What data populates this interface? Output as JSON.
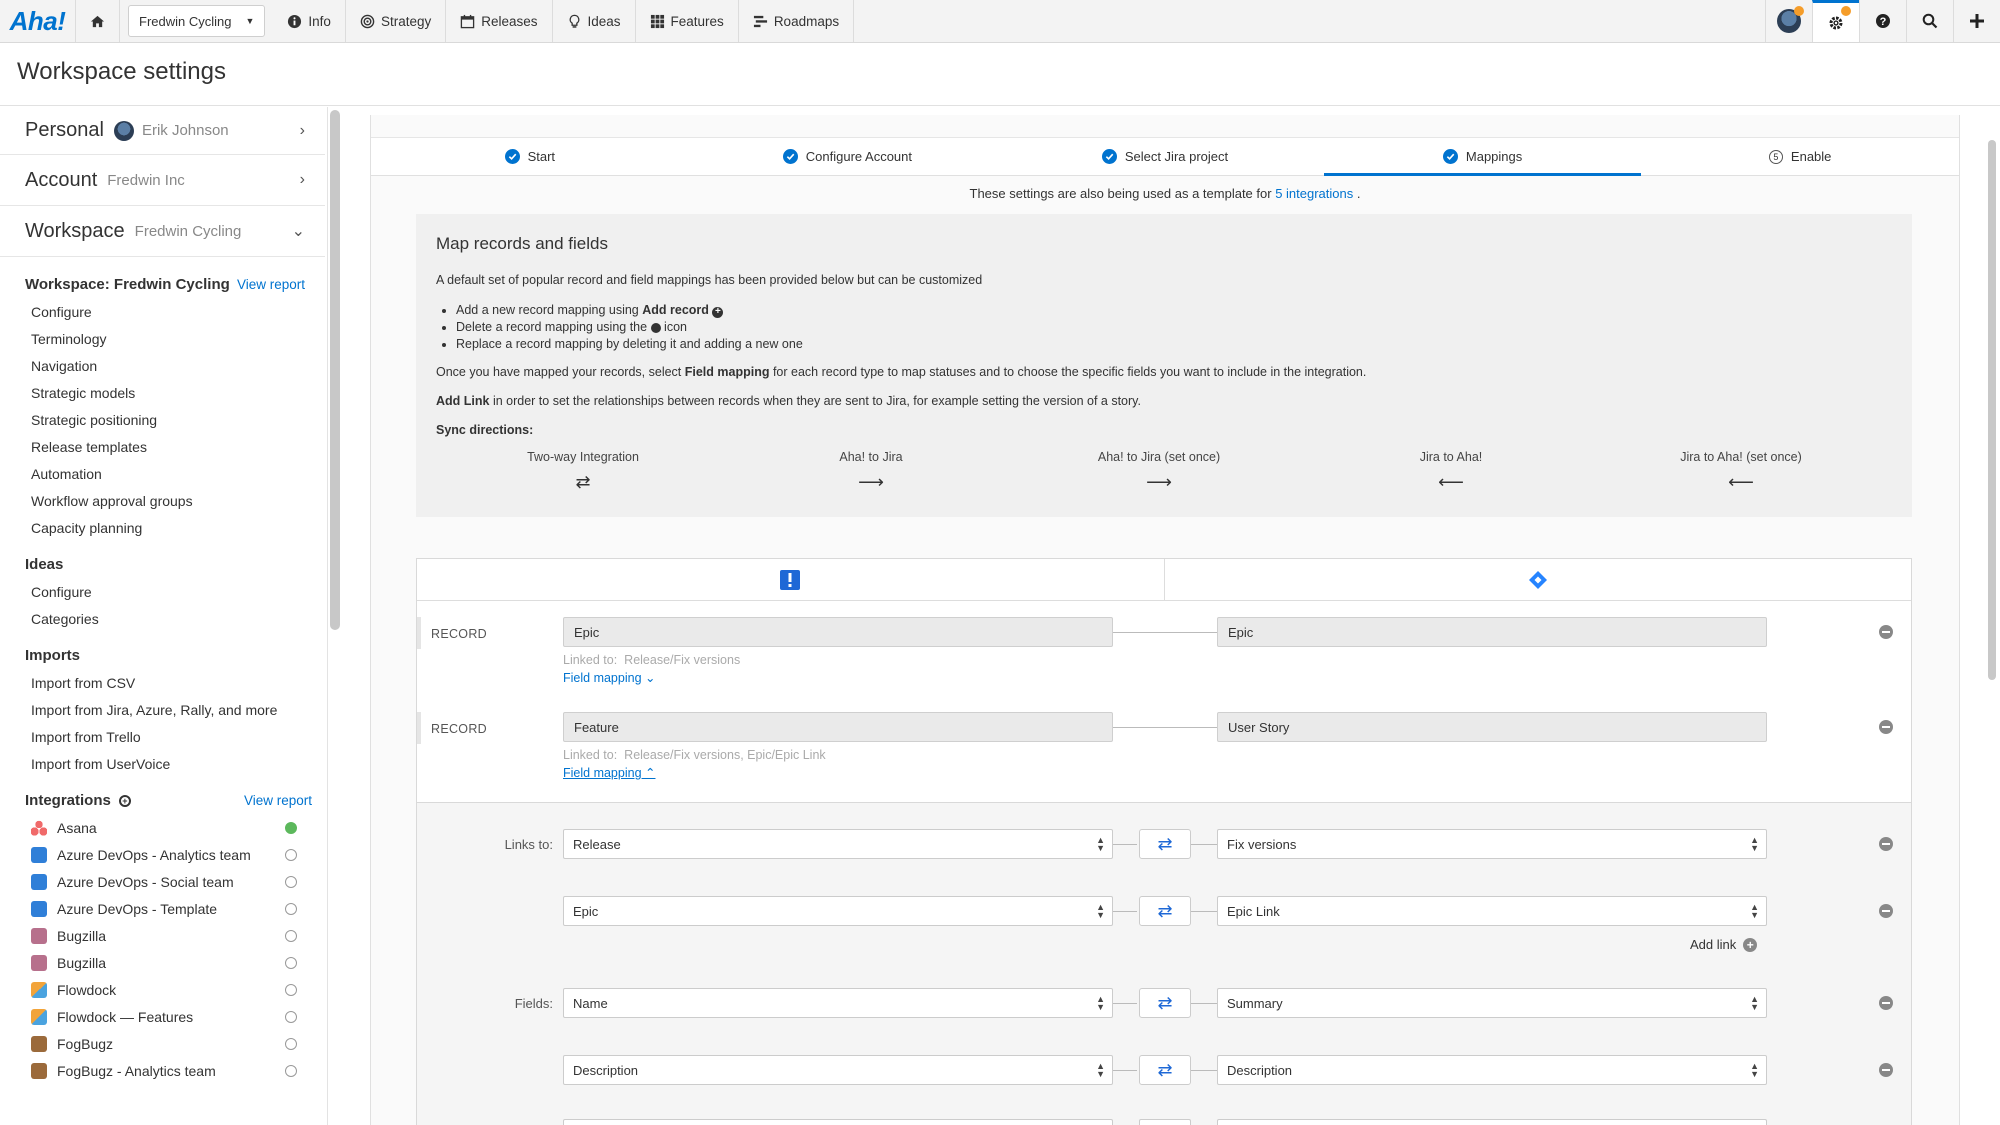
{
  "nav": {
    "logo": "Aha!",
    "workspace": "Fredwin Cycling",
    "items": [
      "Info",
      "Strategy",
      "Releases",
      "Ideas",
      "Features",
      "Roadmaps"
    ]
  },
  "page": {
    "title": "Workspace settings"
  },
  "sidebar": {
    "personal": {
      "label": "Personal",
      "value": "Erik Johnson"
    },
    "account": {
      "label": "Account",
      "value": "Fredwin Inc"
    },
    "workspace": {
      "label": "Workspace",
      "value": "Fredwin Cycling"
    },
    "ws_section": {
      "title": "Workspace: Fredwin Cycling",
      "link": "View report",
      "items": [
        "Configure",
        "Terminology",
        "Navigation",
        "Strategic models",
        "Strategic positioning",
        "Release templates",
        "Automation",
        "Workflow approval groups",
        "Capacity planning"
      ]
    },
    "ideas": {
      "title": "Ideas",
      "items": [
        "Configure",
        "Categories"
      ]
    },
    "imports": {
      "title": "Imports",
      "items": [
        "Import from CSV",
        "Import from Jira, Azure, Rally, and more",
        "Import from Trello",
        "Import from UserVoice"
      ]
    },
    "integrations": {
      "title": "Integrations",
      "link": "View report",
      "items": [
        "Asana",
        "Azure DevOps - Analytics team",
        "Azure DevOps - Social team",
        "Azure DevOps - Template",
        "Bugzilla",
        "Bugzilla",
        "Flowdock",
        "Flowdock — Features",
        "FogBugz",
        "FogBugz - Analytics team"
      ]
    }
  },
  "steps": [
    "Start",
    "Configure Account",
    "Select Jira project",
    "Mappings",
    "Enable"
  ],
  "template_note": {
    "before": "These settings are also being used as a template for ",
    "link": "5 integrations",
    "after": " ."
  },
  "map": {
    "title": "Map records and fields",
    "intro": "A default set of popular record and field mappings has been provided below but can be customized",
    "bullet1_a": "Add a new record mapping using ",
    "bullet1_b": "Add record",
    "bullet2_a": "Delete a record mapping using the ",
    "bullet2_b": "icon",
    "bullet3": "Replace a record mapping by deleting it and adding a new one",
    "p2_a": "Once you have mapped your records, select ",
    "p2_b": "Field mapping",
    "p2_c": " for each record type to map statuses and to choose the specific fields you want to include in the integration.",
    "p3_a": "Add Link",
    "p3_b": " in order to set the relationships between records when they are sent to Jira, for example setting the version of a story.",
    "sync_title": "Sync directions:",
    "sync": [
      "Two-way Integration",
      "Aha! to Jira",
      "Aha! to Jira (set once)",
      "Jira to Aha!",
      "Jira to Aha! (set once)"
    ]
  },
  "records": [
    {
      "label": "RECORD",
      "aha": "Epic",
      "jira": "Epic",
      "linked_label": "Linked to:",
      "linked": "Release/Fix versions",
      "field_mapping": "Field mapping"
    },
    {
      "label": "RECORD",
      "aha": "Feature",
      "jira": "User Story",
      "linked_label": "Linked to:",
      "linked": "Release/Fix versions, Epic/Epic Link",
      "field_mapping": "Field mapping"
    }
  ],
  "links": {
    "label": "Links to:",
    "rows": [
      {
        "aha": "Release",
        "jira": "Fix versions"
      },
      {
        "aha": "Epic",
        "jira": "Epic Link"
      }
    ],
    "add": "Add link"
  },
  "fields": {
    "label": "Fields:",
    "rows": [
      {
        "aha": "Name",
        "jira": "Summary"
      },
      {
        "aha": "Description",
        "jira": "Description"
      }
    ]
  }
}
